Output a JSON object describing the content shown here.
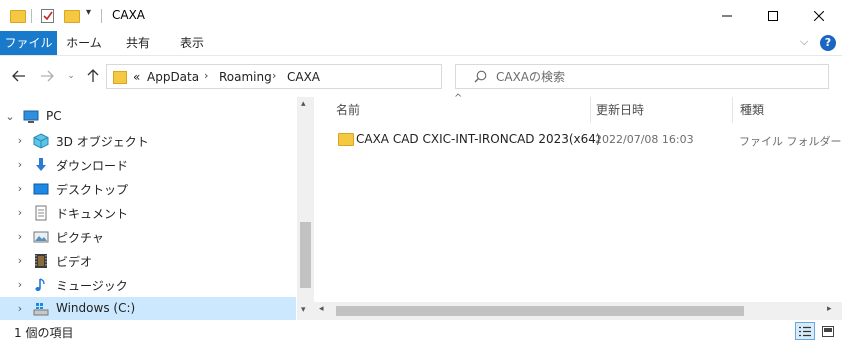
{
  "window": {
    "title": "CAXA",
    "controls": {
      "minimize": "minimize",
      "maximize": "maximize",
      "close": "close"
    }
  },
  "ribbon": {
    "tabs": [
      "ファイル",
      "ホーム",
      "共有",
      "表示"
    ],
    "help_label": "?"
  },
  "address": {
    "overflow": "«",
    "crumbs": [
      "AppData",
      "Roaming",
      "CAXA"
    ]
  },
  "search": {
    "placeholder": "CAXAの検索"
  },
  "nav": {
    "items": [
      {
        "label": "PC",
        "icon": "pc-icon"
      },
      {
        "label": "3D オブジェクト",
        "icon": "3d-objects-icon"
      },
      {
        "label": "ダウンロード",
        "icon": "download-icon"
      },
      {
        "label": "デスクトップ",
        "icon": "desktop-icon"
      },
      {
        "label": "ドキュメント",
        "icon": "documents-icon"
      },
      {
        "label": "ピクチャ",
        "icon": "pictures-icon"
      },
      {
        "label": "ビデオ",
        "icon": "videos-icon"
      },
      {
        "label": "ミュージック",
        "icon": "music-icon"
      },
      {
        "label": "Windows (C:)",
        "icon": "drive-icon"
      }
    ]
  },
  "content": {
    "columns": [
      "名前",
      "更新日時",
      "種類"
    ],
    "rows": [
      {
        "name": "CAXA CAD CXIC-INT-IRONCAD 2023(x64)",
        "modified": "2022/07/08 16:03",
        "type": "ファイル フォルダー"
      }
    ]
  },
  "status": {
    "item_count": "1 個の項目"
  },
  "colors": {
    "accent": "#1979ca",
    "selection": "#cce8ff",
    "folder": "#f5c842"
  }
}
